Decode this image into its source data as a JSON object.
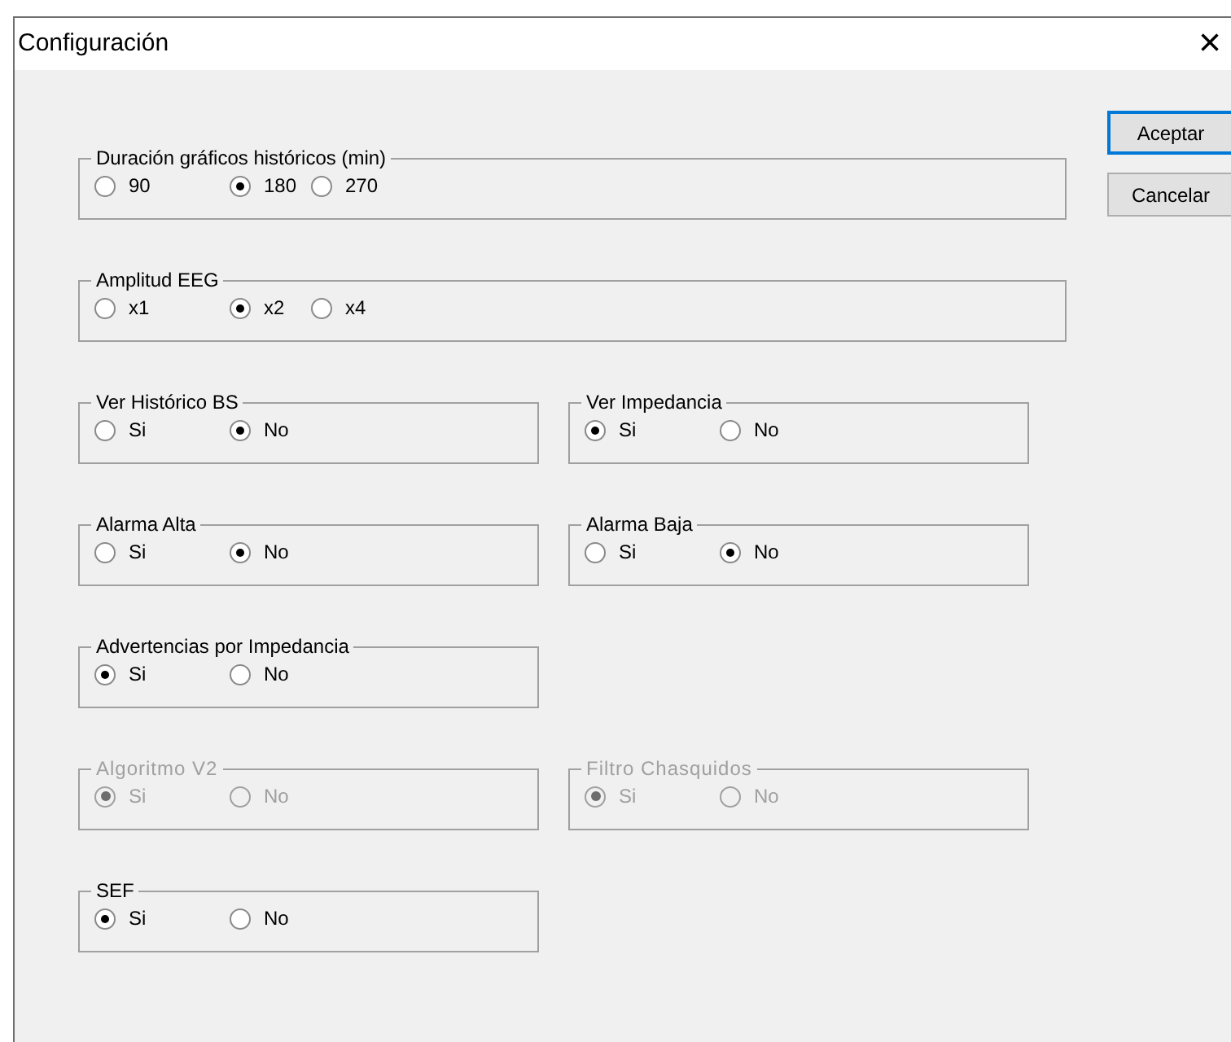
{
  "window": {
    "title": "Configuración",
    "close": "×"
  },
  "rows": [
    {
      "groups": [
        {
          "kind": "wide",
          "title": "Duración gráficos históricos (min)",
          "disabled": false,
          "options": [
            {
              "label": "90",
              "selected": false
            },
            {
              "label": "180",
              "selected": true
            },
            {
              "label": "270",
              "selected": false
            }
          ]
        }
      ]
    },
    {
      "groups": [
        {
          "kind": "wide",
          "title": "Amplitud EEG",
          "disabled": false,
          "options": [
            {
              "label": "x1",
              "selected": false
            },
            {
              "label": "x2",
              "selected": true
            },
            {
              "label": "x4",
              "selected": false
            }
          ]
        }
      ]
    },
    {
      "groups": [
        {
          "kind": "half",
          "title": "Ver Histórico BS",
          "disabled": false,
          "options": [
            {
              "label": "Si",
              "selected": false
            },
            {
              "label": "No",
              "selected": true
            }
          ]
        },
        {
          "kind": "half",
          "title": "Ver Impedancia",
          "disabled": false,
          "options": [
            {
              "label": "Si",
              "selected": true
            },
            {
              "label": "No",
              "selected": false
            }
          ]
        }
      ]
    },
    {
      "groups": [
        {
          "kind": "half",
          "title": "Alarma Alta",
          "disabled": false,
          "options": [
            {
              "label": "Si",
              "selected": false
            },
            {
              "label": "No",
              "selected": true
            }
          ]
        },
        {
          "kind": "half",
          "title": "Alarma Baja",
          "disabled": false,
          "options": [
            {
              "label": "Si",
              "selected": false
            },
            {
              "label": "No",
              "selected": true
            }
          ]
        }
      ]
    },
    {
      "groups": [
        {
          "kind": "half",
          "title": "Advertencias por Impedancia",
          "disabled": false,
          "options": [
            {
              "label": "Si",
              "selected": true
            },
            {
              "label": "No",
              "selected": false
            }
          ]
        }
      ]
    },
    {
      "groups": [
        {
          "kind": "half",
          "title": "Algoritmo V2",
          "disabled": true,
          "options": [
            {
              "label": "Si",
              "selected": true
            },
            {
              "label": "No",
              "selected": false
            }
          ]
        },
        {
          "kind": "half",
          "title": "Filtro Chasquidos",
          "disabled": true,
          "options": [
            {
              "label": "Si",
              "selected": true
            },
            {
              "label": "No",
              "selected": false
            }
          ]
        }
      ]
    },
    {
      "groups": [
        {
          "kind": "half",
          "title": "SEF",
          "disabled": false,
          "options": [
            {
              "label": "Si",
              "selected": true
            },
            {
              "label": "No",
              "selected": false
            }
          ]
        }
      ]
    }
  ],
  "buttons": [
    {
      "label": "Aceptar",
      "default": true
    },
    {
      "label": "Cancelar",
      "default": false
    }
  ]
}
